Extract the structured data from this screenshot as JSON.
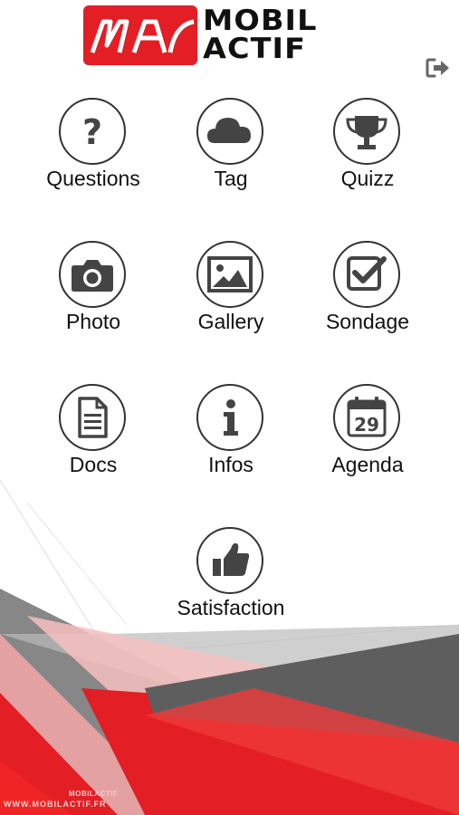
{
  "brand": {
    "line1": "MOBIL",
    "line2": "ACTIF"
  },
  "menu": [
    {
      "label": "Questions",
      "icon": "question-icon"
    },
    {
      "label": "Tag",
      "icon": "cloud-icon"
    },
    {
      "label": "Quizz",
      "icon": "trophy-icon"
    },
    {
      "label": "Photo",
      "icon": "camera-icon"
    },
    {
      "label": "Gallery",
      "icon": "image-icon"
    },
    {
      "label": "Sondage",
      "icon": "checkbox-icon"
    },
    {
      "label": "Docs",
      "icon": "document-icon"
    },
    {
      "label": "Infos",
      "icon": "info-icon"
    },
    {
      "label": "Agenda",
      "icon": "calendar-icon",
      "day": "29"
    },
    {
      "label": "Satisfaction",
      "icon": "thumbs-up-icon"
    }
  ],
  "footer": {
    "brand": "MOBILACTIF",
    "url": "WWW.MOBILACTIF.FR"
  },
  "colors": {
    "accent": "#e31e24",
    "dark": "#444444",
    "grey": "#777777"
  }
}
